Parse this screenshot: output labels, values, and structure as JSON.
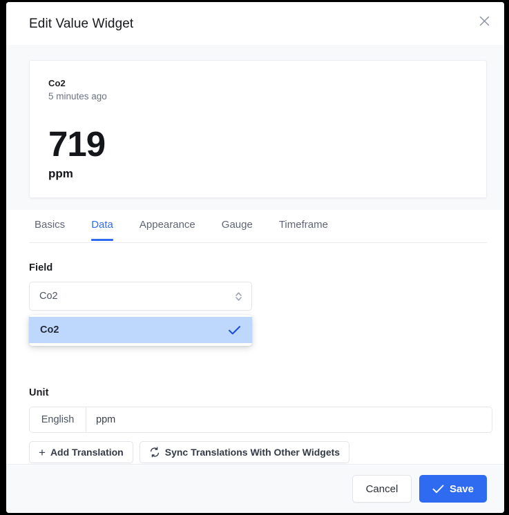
{
  "dialog": {
    "title": "Edit Value Widget",
    "close_icon": "close-icon"
  },
  "preview": {
    "name": "Co2",
    "timestamp": "5 minutes ago",
    "value": "719",
    "unit": "ppm"
  },
  "tabs": [
    {
      "label": "Basics",
      "active": false
    },
    {
      "label": "Data",
      "active": true
    },
    {
      "label": "Appearance",
      "active": false
    },
    {
      "label": "Gauge",
      "active": false
    },
    {
      "label": "Timeframe",
      "active": false
    }
  ],
  "field": {
    "label": "Field",
    "selected_value": "Co2",
    "stepper_icon": "chevron-up-down-icon",
    "dropdown": {
      "options": [
        {
          "label": "Co2",
          "selected": true,
          "check_icon": "check-icon"
        }
      ]
    }
  },
  "unit": {
    "label": "Unit",
    "language": "English",
    "value": "ppm",
    "placeholder": "",
    "add_translation_label": "Add Translation",
    "add_translation_icon": "plus-icon",
    "sync_label": "Sync Translations With Other Widgets",
    "sync_icon": "sync-icon"
  },
  "footer": {
    "cancel_label": "Cancel",
    "save_label": "Save",
    "save_icon": "check-icon"
  },
  "colors": {
    "accent": "#2f6bf0",
    "highlight": "#bdd7fd",
    "panel_bg": "#f7f9fb",
    "border": "#e4e6ea",
    "text": "#1c1e21",
    "muted": "#6b7280"
  }
}
